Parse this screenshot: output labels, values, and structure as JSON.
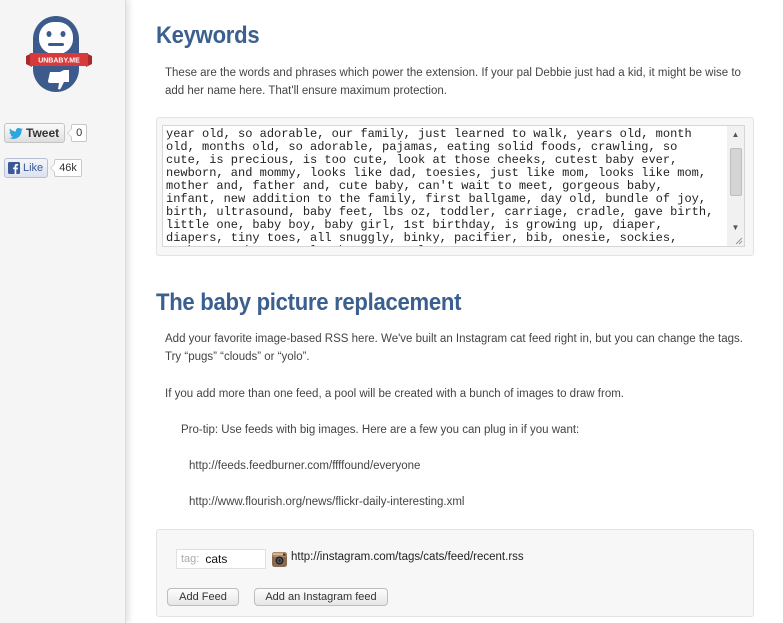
{
  "sidebar": {
    "logo_text": "UNBABY.ME",
    "tweet": {
      "label": "Tweet",
      "count": "0"
    },
    "like": {
      "label": "Like",
      "count": "46k"
    }
  },
  "keywords": {
    "title": "Keywords",
    "description": "These are the words and phrases which power the extension. If your pal Debbie just had a kid, it might be wise to add her name here. That'll ensure maximum protection.",
    "value": "year old, so adorable, our family, just learned to walk, years old, month old, months old, so adorable, pajamas, eating solid foods, crawling, so cute, is precious, is too cute, look at those cheeks, cutest baby ever, newborn, and mommy, looks like dad, toesies, just like mom, looks like mom, mother and, father and, cute baby, can't wait to meet, gorgeous baby, infant, new addition to the family, first ballgame, day old, bundle of joy, birth, ultrasound, baby feet, lbs oz, toddler, carriage, cradle, gave birth, little one, baby boy, baby girl, 1st birthday, is growing up, diaper, diapers, tiny toes, all snuggly, binky, pacifier, bib, onesie, sockies, gerber, such an angel, what an angel,"
  },
  "replacement": {
    "title": "The baby picture replacement",
    "description1": "Add your favorite image-based RSS here. We've built an Instagram cat feed right in, but you can change the tags. Try “pugs” “clouds” or “yolo”.",
    "description2": "If you add more than one feed, a pool will be created with a bunch of images to draw from.",
    "protip": "Pro-tip: Use feeds with big images. Here are a few you can plug in if you want:",
    "url1": "http://feeds.feedburner.com/ffffound/everyone",
    "url2": "http://www.flourish.org/news/flickr-daily-interesting.xml",
    "feed": {
      "tag_label": "tag:",
      "tag_value": "cats",
      "url": "http://instagram.com/tags/cats/feed/recent.rss"
    },
    "buttons": {
      "add_feed": "Add Feed",
      "add_instagram": "Add an Instagram feed"
    }
  },
  "colors": {
    "heading": "#3b5f8e",
    "logo_blue": "#3d5a8c",
    "logo_red": "#d63a3a"
  }
}
